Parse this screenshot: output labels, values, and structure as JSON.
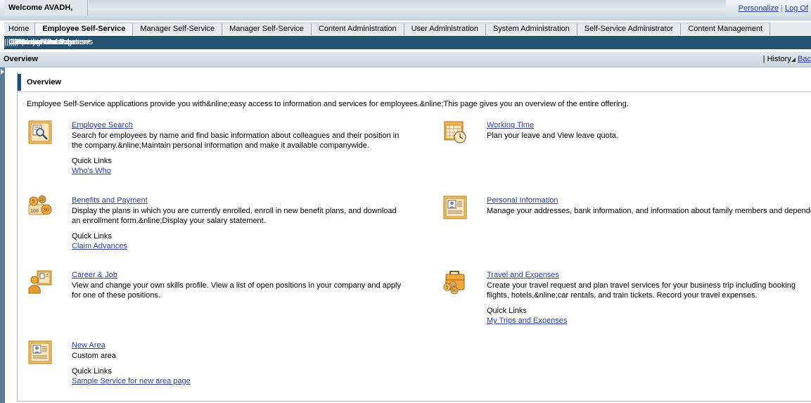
{
  "header": {
    "welcome": "Welcome AVADH,",
    "links": [
      "Personalize",
      "Log Of"
    ]
  },
  "tabs": [
    {
      "label": "Home",
      "active": false
    },
    {
      "label": "Employee Self-Service",
      "active": true
    },
    {
      "label": "Manager Self-Service",
      "active": false
    },
    {
      "label": "Manager Self-Service",
      "active": false
    },
    {
      "label": "Content Administration",
      "active": false
    },
    {
      "label": "User Administration",
      "active": false
    },
    {
      "label": "System Administration",
      "active": false
    },
    {
      "label": "Self-Service Administrator",
      "active": false
    },
    {
      "label": "Content Management",
      "active": false
    }
  ],
  "subnav": [
    {
      "label": "Overview",
      "active": true
    },
    {
      "label": "Employee Search",
      "active": false
    },
    {
      "label": "Working Time",
      "active": false
    },
    {
      "label": "Benefits and Payment",
      "active": false
    },
    {
      "label": "Personal Information",
      "active": false
    },
    {
      "label": "Career and Job",
      "active": false
    },
    {
      "label": "Travel and Expenses",
      "active": false
    },
    {
      "label": "New Area",
      "active": false
    }
  ],
  "pagebar": {
    "title": "Overview",
    "separator": "|",
    "history": "History",
    "back": "Bac"
  },
  "overview": {
    "title": "Overview",
    "intro": "Employee Self-Service applications provide you with&nline;easy access to information and services for employees.&nline;This page gives you an overview of the entire offering."
  },
  "areas": [
    {
      "key": "employee-search",
      "name": "Employee Search",
      "icon": "employee-search-icon",
      "desc": "Search for employees by name and find basic information about colleagues and their position in the company.&nline;Maintain personal information and make it available companywide.",
      "quick_links_label": "Quick Links",
      "quick_link": "Who's Who"
    },
    {
      "key": "working-time",
      "name": "Working Time",
      "icon": "calendar-clock-icon",
      "desc": "Plan your leave and View leave quota.",
      "quick_links_label": "",
      "quick_link": ""
    },
    {
      "key": "benefits-payment",
      "name": "Benefits and Payment",
      "icon": "coins-icon",
      "icon_text": [
        "5",
        "10",
        "100",
        "50"
      ],
      "desc": "Display the plans in which you are currently enrolled, enroll in new benefit plans, and download an enrollment form.&nline;Display your salary statement.",
      "quick_links_label": "Quick Links",
      "quick_link": "Claim Advances"
    },
    {
      "key": "personal-information",
      "name": "Personal Information",
      "icon": "id-card-icon",
      "desc": "Manage your addresses, bank information, and information about family members and dependents.",
      "quick_links_label": "",
      "quick_link": ""
    },
    {
      "key": "career-job",
      "name": "Career & Job",
      "icon": "career-icon",
      "desc": "View and change your own skills profile. View a list of open positions in your company and apply for one of these positions.",
      "quick_links_label": "",
      "quick_link": ""
    },
    {
      "key": "travel-expenses",
      "name": "Travel and Expenses",
      "icon": "suitcase-coins-icon",
      "icon_text": [
        "5",
        "10",
        "50"
      ],
      "desc": "Create your travel request and plan travel services for your business trip including booking flights, hotels,&nline;car rentals, and train tickets. Record your travel expenses.",
      "quick_links_label": "Quick Links",
      "quick_link": "My Trips and Expenses"
    },
    {
      "key": "new-area",
      "name": "New Area",
      "icon": "id-card-icon",
      "desc": "Custom area",
      "quick_links_label": "Quick Links",
      "quick_link": "Sample Service for new area page"
    }
  ],
  "colors": {
    "subnav_bg": "#27526f",
    "link": "#2a3f9c",
    "accent_bar": "#1e4f7a",
    "icon_orange": "#e9a63a"
  }
}
